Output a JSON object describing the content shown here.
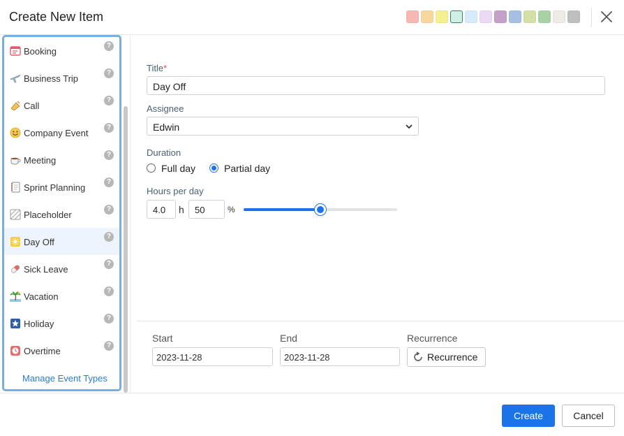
{
  "dialog": {
    "title": "Create New Item"
  },
  "swatches": [
    {
      "name": "swatch-pink",
      "color": "#f7b7b2"
    },
    {
      "name": "swatch-peach",
      "color": "#f8d79f"
    },
    {
      "name": "swatch-yellow",
      "color": "#f4f08f"
    },
    {
      "name": "swatch-mint",
      "color": "#cdf1e4",
      "selected": true
    },
    {
      "name": "swatch-sky",
      "color": "#d8ebfb"
    },
    {
      "name": "swatch-lilac",
      "color": "#ecd8f8"
    },
    {
      "name": "swatch-purple",
      "color": "#c5a0c9"
    },
    {
      "name": "swatch-blue",
      "color": "#a7bfe3"
    },
    {
      "name": "swatch-lime",
      "color": "#d3e1a4"
    },
    {
      "name": "swatch-green",
      "color": "#a6d2a6"
    },
    {
      "name": "swatch-cream",
      "color": "#eeebe4"
    },
    {
      "name": "swatch-gray",
      "color": "#bfbfbf"
    }
  ],
  "sidebar": {
    "help_symbol": "?",
    "items": [
      {
        "label": "Booking",
        "icon": "booking-icon"
      },
      {
        "label": "Business Trip",
        "icon": "airplane-icon"
      },
      {
        "label": "Call",
        "icon": "phone-call-icon"
      },
      {
        "label": "Company Event",
        "icon": "smiley-icon"
      },
      {
        "label": "Meeting",
        "icon": "coffee-cup-icon"
      },
      {
        "label": "Sprint Planning",
        "icon": "notebook-icon"
      },
      {
        "label": "Placeholder",
        "icon": "placeholder-icon"
      },
      {
        "label": "Day Off",
        "icon": "sun-icon",
        "active": true
      },
      {
        "label": "Sick Leave",
        "icon": "pill-icon"
      },
      {
        "label": "Vacation",
        "icon": "palm-tree-icon"
      },
      {
        "label": "Holiday",
        "icon": "star-icon"
      },
      {
        "label": "Overtime",
        "icon": "clock-icon"
      }
    ],
    "manage_label": "Manage Event Types"
  },
  "form": {
    "title_label": "Title",
    "title_required": "*",
    "title_value": "Day Off",
    "assignee_label": "Assignee",
    "assignee_value": "Edwin",
    "duration_label": "Duration",
    "duration_options": [
      {
        "label": "Full day",
        "checked": false
      },
      {
        "label": "Partial day",
        "checked": true
      }
    ],
    "hours_label": "Hours per day",
    "hours_value": "4.0",
    "hours_unit": "h",
    "percent_value": "50",
    "percent_unit": "%",
    "slider_percent": 50,
    "start_label": "Start",
    "start_value": "2023-11-28",
    "end_label": "End",
    "end_value": "2023-11-28",
    "recurrence_label": "Recurrence",
    "recurrence_button": "Recurrence"
  },
  "footer": {
    "create_label": "Create",
    "cancel_label": "Cancel"
  }
}
